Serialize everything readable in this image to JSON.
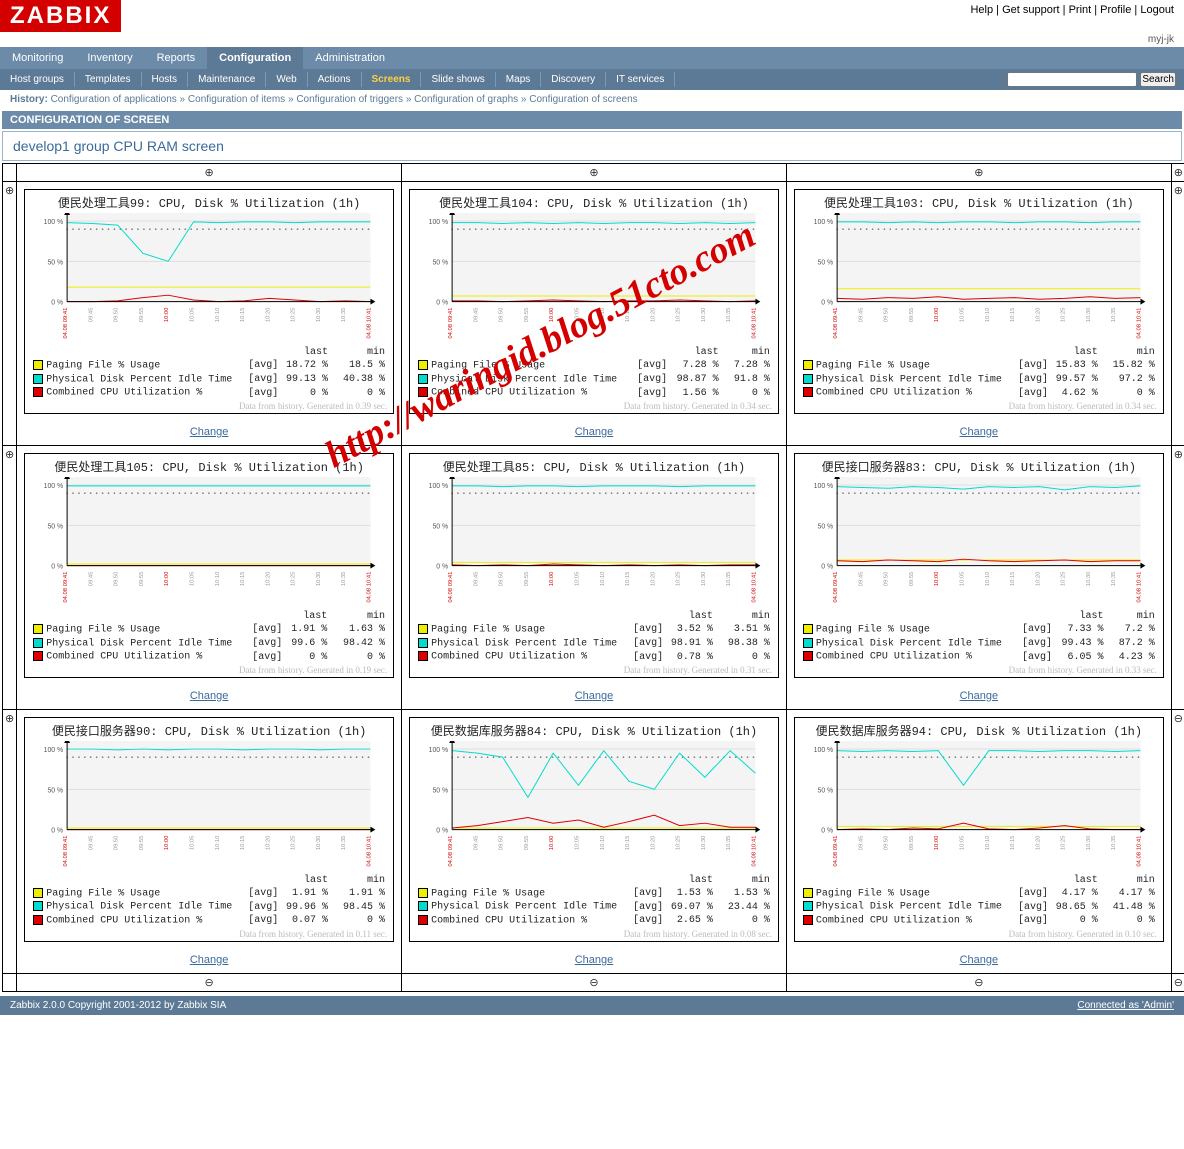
{
  "brand": "ZABBIX",
  "top_links": [
    "Help",
    "Get support",
    "Print",
    "Profile",
    "Logout"
  ],
  "user": "myj-jk",
  "main_nav": [
    "Monitoring",
    "Inventory",
    "Reports",
    "Configuration",
    "Administration"
  ],
  "main_nav_active": "Configuration",
  "sub_nav": [
    "Host groups",
    "Templates",
    "Hosts",
    "Maintenance",
    "Web",
    "Actions",
    "Screens",
    "Slide shows",
    "Maps",
    "Discovery",
    "IT services"
  ],
  "sub_nav_active": "Screens",
  "search_btn": "Search",
  "history_label": "History:",
  "history": [
    "Configuration of applications",
    "Configuration of items",
    "Configuration of triggers",
    "Configuration of graphs",
    "Configuration of screens"
  ],
  "section": "CONFIGURATION OF SCREEN",
  "screen_title": "develop1 group CPU RAM screen",
  "change_label": "Change",
  "add_icon": "⊕",
  "remove_icon": "⊖",
  "legend_labels": {
    "paging": "Paging File % Usage",
    "disk": "Physical Disk Percent Idle Time",
    "cpu": "Combined CPU Utilization %",
    "avg": "[avg]",
    "last": "last",
    "min": "min"
  },
  "colors": {
    "paging": "#EEEE00",
    "disk": "#00DDCC",
    "cpu": "#DD0000"
  },
  "xticks": [
    "04.08 09:41",
    "09:45",
    "09:50",
    "09:55",
    "10:00",
    "10:05",
    "10:10",
    "10:15",
    "10:20",
    "10:25",
    "10:30",
    "10:35",
    "04.08 10:41"
  ],
  "footer_left": "Zabbix 2.0.0 Copyright 2001-2012 by Zabbix SIA",
  "footer_right": "Connected as 'Admin'",
  "watermark": "http://waringid.blog.51cto.com",
  "chart_data": [
    {
      "title": "便民处理工具99: CPU, Disk % Utilization (1h)",
      "paging_last": "18.72 %",
      "paging_min": "18.5 %",
      "disk_last": "99.13 %",
      "disk_min": "40.38 %",
      "cpu_last": "0 %",
      "cpu_min": "0 %",
      "gen": "Data from history. Generated in 0.39 sec.",
      "paging": [
        18,
        18,
        18,
        18,
        18,
        18,
        18,
        18,
        18,
        18,
        18,
        18,
        18
      ],
      "disk": [
        98,
        97,
        95,
        60,
        50,
        99,
        98,
        99,
        99,
        98,
        99,
        99,
        99
      ],
      "cpu": [
        0,
        0,
        1,
        5,
        8,
        2,
        0,
        1,
        4,
        2,
        0,
        1,
        0
      ]
    },
    {
      "title": "便民处理工具104: CPU, Disk % Utilization (1h)",
      "paging_last": "7.28 %",
      "paging_min": "7.28 %",
      "disk_last": "98.87 %",
      "disk_min": "91.8 %",
      "cpu_last": "1.56 %",
      "cpu_min": "0 %",
      "gen": "Data from history. Generated in 0.34 sec.",
      "paging": [
        7,
        7,
        7,
        7,
        7,
        7,
        7,
        7,
        7,
        7,
        7,
        7,
        7
      ],
      "disk": [
        98,
        98,
        97,
        98,
        97,
        98,
        97,
        98,
        98,
        97,
        98,
        97,
        98
      ],
      "cpu": [
        1,
        1,
        0,
        1,
        2,
        1,
        0,
        1,
        1,
        2,
        1,
        0,
        1
      ]
    },
    {
      "title": "便民处理工具103: CPU, Disk % Utilization (1h)",
      "paging_last": "15.83 %",
      "paging_min": "15.82 %",
      "disk_last": "99.57 %",
      "disk_min": "97.2 %",
      "cpu_last": "4.62 %",
      "cpu_min": "0 %",
      "gen": "Data from history. Generated in 0.34 sec.",
      "paging": [
        16,
        16,
        16,
        16,
        16,
        16,
        16,
        16,
        16,
        16,
        16,
        16,
        16
      ],
      "disk": [
        99,
        99,
        98,
        99,
        98,
        99,
        99,
        98,
        99,
        99,
        98,
        99,
        99
      ],
      "cpu": [
        4,
        3,
        5,
        4,
        6,
        3,
        4,
        5,
        3,
        4,
        6,
        4,
        5
      ]
    },
    {
      "title": "便民处理工具105: CPU, Disk % Utilization (1h)",
      "paging_last": "1.91 %",
      "paging_min": "1.63 %",
      "disk_last": "99.6 %",
      "disk_min": "98.42 %",
      "cpu_last": "0 %",
      "cpu_min": "0 %",
      "gen": "Data from history. Generated in 0.19 sec.",
      "paging": [
        2,
        2,
        2,
        2,
        2,
        2,
        2,
        2,
        2,
        2,
        2,
        2,
        2
      ],
      "disk": [
        99,
        99,
        99,
        99,
        99,
        99,
        99,
        99,
        99,
        99,
        99,
        99,
        99
      ],
      "cpu": [
        0,
        0,
        0,
        0,
        0,
        0,
        0,
        0,
        0,
        0,
        0,
        0,
        0
      ]
    },
    {
      "title": "便民处理工具85: CPU, Disk % Utilization (1h)",
      "paging_last": "3.52 %",
      "paging_min": "3.51 %",
      "disk_last": "98.91 %",
      "disk_min": "98.38 %",
      "cpu_last": "0.78 %",
      "cpu_min": "0 %",
      "gen": "Data from history. Generated in 0.31 sec.",
      "paging": [
        4,
        4,
        4,
        4,
        4,
        4,
        4,
        4,
        4,
        4,
        4,
        4,
        4
      ],
      "disk": [
        99,
        99,
        98,
        99,
        99,
        98,
        99,
        99,
        99,
        98,
        99,
        99,
        99
      ],
      "cpu": [
        1,
        0,
        1,
        0,
        2,
        1,
        0,
        1,
        0,
        1,
        0,
        1,
        1
      ]
    },
    {
      "title": "便民接口服务器83: CPU, Disk % Utilization (1h)",
      "paging_last": "7.33 %",
      "paging_min": "7.2 %",
      "disk_last": "99.43 %",
      "disk_min": "87.2 %",
      "cpu_last": "6.05 %",
      "cpu_min": "4.23 %",
      "gen": "Data from history. Generated in 0.33 sec.",
      "paging": [
        7,
        7,
        7,
        7,
        7,
        7,
        7,
        7,
        7,
        7,
        7,
        7,
        7
      ],
      "disk": [
        98,
        97,
        96,
        98,
        97,
        95,
        98,
        97,
        98,
        94,
        98,
        97,
        99
      ],
      "cpu": [
        6,
        5,
        7,
        6,
        5,
        8,
        6,
        5,
        6,
        7,
        5,
        6,
        6
      ]
    },
    {
      "title": "便民接口服务器90: CPU, Disk % Utilization (1h)",
      "paging_last": "1.91 %",
      "paging_min": "1.91 %",
      "disk_last": "99.96 %",
      "disk_min": "98.45 %",
      "cpu_last": "0.07 %",
      "cpu_min": "0 %",
      "gen": "Data from history. Generated in 0.11 sec.",
      "paging": [
        2,
        2,
        2,
        2,
        2,
        2,
        2,
        2,
        2,
        2,
        2,
        2,
        2
      ],
      "disk": [
        100,
        100,
        99,
        100,
        99,
        100,
        100,
        99,
        100,
        100,
        99,
        100,
        100
      ],
      "cpu": [
        0,
        0,
        0,
        0,
        0,
        0,
        0,
        0,
        0,
        0,
        0,
        0,
        0
      ]
    },
    {
      "title": "便民数据库服务器84: CPU, Disk % Utilization (1h)",
      "paging_last": "1.53 %",
      "paging_min": "1.53 %",
      "disk_last": "69.07 %",
      "disk_min": "23.44 %",
      "cpu_last": "2.65 %",
      "cpu_min": "0 %",
      "gen": "Data from history. Generated in 0.08 sec.",
      "paging": [
        2,
        2,
        2,
        2,
        2,
        2,
        2,
        2,
        2,
        2,
        2,
        2,
        2
      ],
      "disk": [
        98,
        95,
        90,
        40,
        95,
        55,
        98,
        60,
        50,
        95,
        65,
        98,
        70
      ],
      "cpu": [
        2,
        5,
        10,
        15,
        8,
        12,
        3,
        10,
        18,
        5,
        8,
        3,
        3
      ]
    },
    {
      "title": "便民数据库服务器94: CPU, Disk % Utilization (1h)",
      "paging_last": "4.17 %",
      "paging_min": "4.17 %",
      "disk_last": "98.65 %",
      "disk_min": "41.48 %",
      "cpu_last": "0 %",
      "cpu_min": "0 %",
      "gen": "Data from history. Generated in 0.10 sec.",
      "paging": [
        4,
        4,
        4,
        4,
        4,
        4,
        4,
        4,
        4,
        4,
        4,
        4,
        4
      ],
      "disk": [
        98,
        97,
        98,
        97,
        98,
        55,
        98,
        98,
        97,
        98,
        98,
        97,
        98
      ],
      "cpu": [
        0,
        1,
        0,
        2,
        1,
        8,
        1,
        0,
        2,
        5,
        1,
        0,
        0
      ]
    }
  ]
}
